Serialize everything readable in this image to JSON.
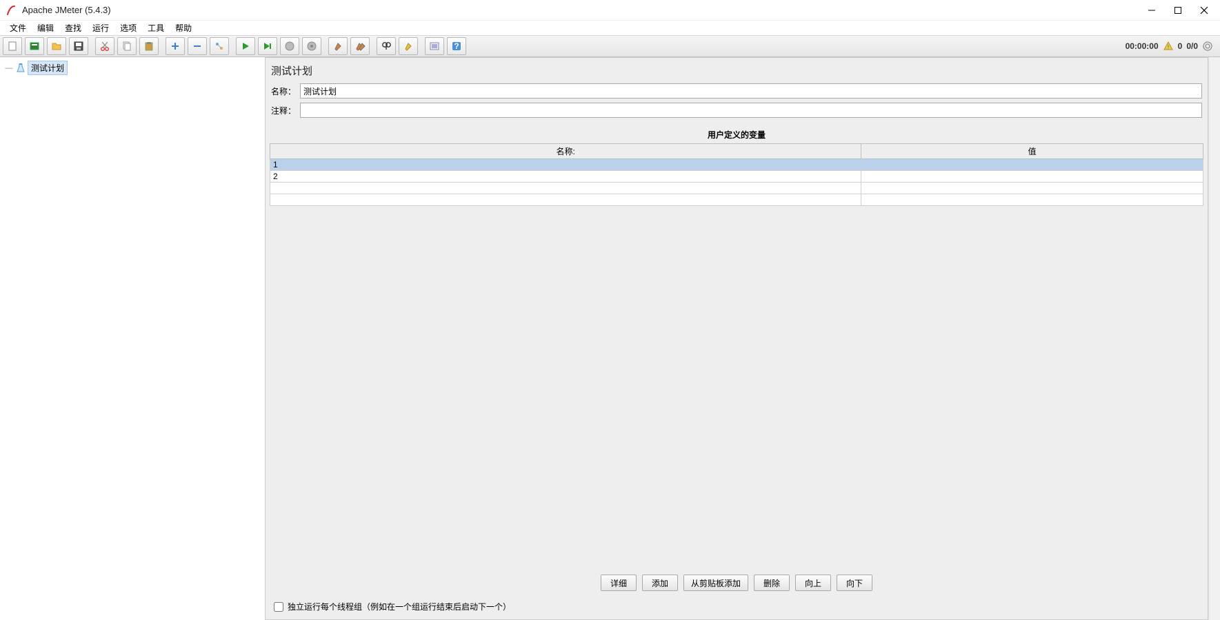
{
  "window": {
    "title": "Apache JMeter (5.4.3)"
  },
  "menu": {
    "items": [
      "文件",
      "编辑",
      "查找",
      "运行",
      "选项",
      "工具",
      "帮助"
    ]
  },
  "toolbar": {
    "buttons": [
      {
        "name": "new"
      },
      {
        "name": "templates"
      },
      {
        "name": "open"
      },
      {
        "name": "save"
      },
      {
        "sep": true
      },
      {
        "name": "cut"
      },
      {
        "name": "copy"
      },
      {
        "name": "paste"
      },
      {
        "sep": true
      },
      {
        "name": "add"
      },
      {
        "name": "remove"
      },
      {
        "name": "disable"
      },
      {
        "sep": true
      },
      {
        "name": "start"
      },
      {
        "name": "start-no-timers"
      },
      {
        "name": "stop"
      },
      {
        "name": "shutdown"
      },
      {
        "sep": true
      },
      {
        "name": "clear"
      },
      {
        "name": "clear-all"
      },
      {
        "sep": true
      },
      {
        "name": "search"
      },
      {
        "name": "reset-search"
      },
      {
        "sep": true
      },
      {
        "name": "function-helper"
      },
      {
        "name": "help"
      }
    ],
    "timer": "00:00:00",
    "warning_count": "0",
    "active_threads": "0/0"
  },
  "tree": {
    "root_label": "测试计划"
  },
  "editor": {
    "title": "测试计划",
    "name_label": "名称：",
    "name_value": "测试计划",
    "comment_label": "注释：",
    "comment_value": "",
    "vars_section_title": "用户定义的变量",
    "table_headers": {
      "name": "名称:",
      "value": "值"
    },
    "table_rows": [
      {
        "name": "1",
        "value": ""
      },
      {
        "name": "2",
        "value": ""
      },
      {
        "name": "",
        "value": ""
      },
      {
        "name": "",
        "value": ""
      }
    ],
    "buttons": {
      "detail": "详细",
      "add": "添加",
      "add_clipboard": "从剪贴板添加",
      "delete": "删除",
      "up": "向上",
      "down": "向下"
    },
    "checkbox_label": "独立运行每个线程组（例如在一个组运行结束后启动下一个）"
  }
}
